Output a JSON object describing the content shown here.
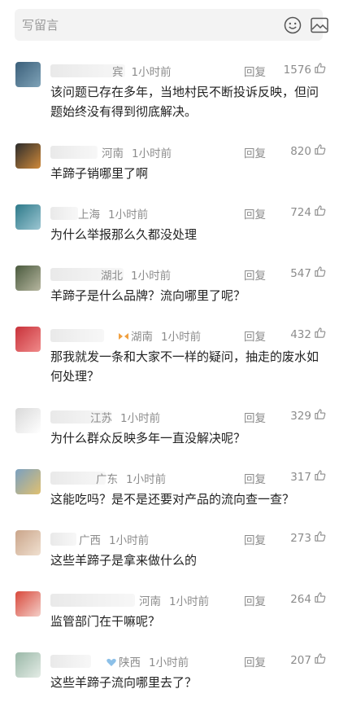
{
  "input": {
    "placeholder": "写留言"
  },
  "reply_label": "回复",
  "comments": [
    {
      "name_tail": "宾",
      "location": "",
      "time": "1小时前",
      "likes": "1576",
      "text": "该问题已存在多年，当地村民不断投诉反映，但问题始终没有得到彻底解决。",
      "avatar_colors": [
        "#3b5f7a",
        "#7fa3b8"
      ]
    },
    {
      "name_tail": "",
      "location": "河南",
      "time": "1小时前",
      "likes": "820",
      "text": "羊蹄子销哪里了啊",
      "avatar_colors": [
        "#2c2c2c",
        "#d08a3a"
      ]
    },
    {
      "name_tail": "",
      "location": "上海",
      "time": "1小时前",
      "likes": "724",
      "text": "为什么举报那么久都没处理",
      "avatar_colors": [
        "#2e7a8a",
        "#9cc6d2"
      ]
    },
    {
      "name_tail": "",
      "location": "湖北",
      "time": "1小时前",
      "likes": "547",
      "text": "羊蹄子是什么品牌？流向哪里了呢？",
      "avatar_colors": [
        "#4a5a3e",
        "#b7b7a0"
      ]
    },
    {
      "name_tail": "",
      "location": "湖南",
      "time": "1小时前",
      "likes": "432",
      "text": "那我就发一条和大家不一样的疑问，抽走的废水如何处理？",
      "avatar_colors": [
        "#c8323a",
        "#f08a8a"
      ]
    },
    {
      "name_tail": "",
      "location": "江苏",
      "time": "1小时前",
      "likes": "329",
      "text": "为什么群众反映多年一直没解决呢？",
      "avatar_colors": [
        "#d9d9d9",
        "#ffffff"
      ]
    },
    {
      "name_tail": "",
      "location": "广东",
      "time": "1小时前",
      "likes": "317",
      "text": "这能吃吗？是不是还要对产品的流向查一查？",
      "avatar_colors": [
        "#7aa0c0",
        "#e0c070"
      ]
    },
    {
      "name_tail": "",
      "location": "广西",
      "time": "1小时前",
      "likes": "273",
      "text": "这些羊蹄子是拿来做什么的",
      "avatar_colors": [
        "#caa58a",
        "#f0e0d0"
      ]
    },
    {
      "name_tail": "",
      "location": "河南",
      "time": "1小时前",
      "likes": "264",
      "text": "监管部门在干嘛呢？",
      "avatar_colors": [
        "#d8493c",
        "#f4cfc8"
      ]
    },
    {
      "name_tail": "",
      "location": "陕西",
      "time": "1小时前",
      "likes": "207",
      "text": "这些羊蹄子流向哪里去了？",
      "avatar_colors": [
        "#9ab8a8",
        "#e4ece6"
      ]
    }
  ]
}
